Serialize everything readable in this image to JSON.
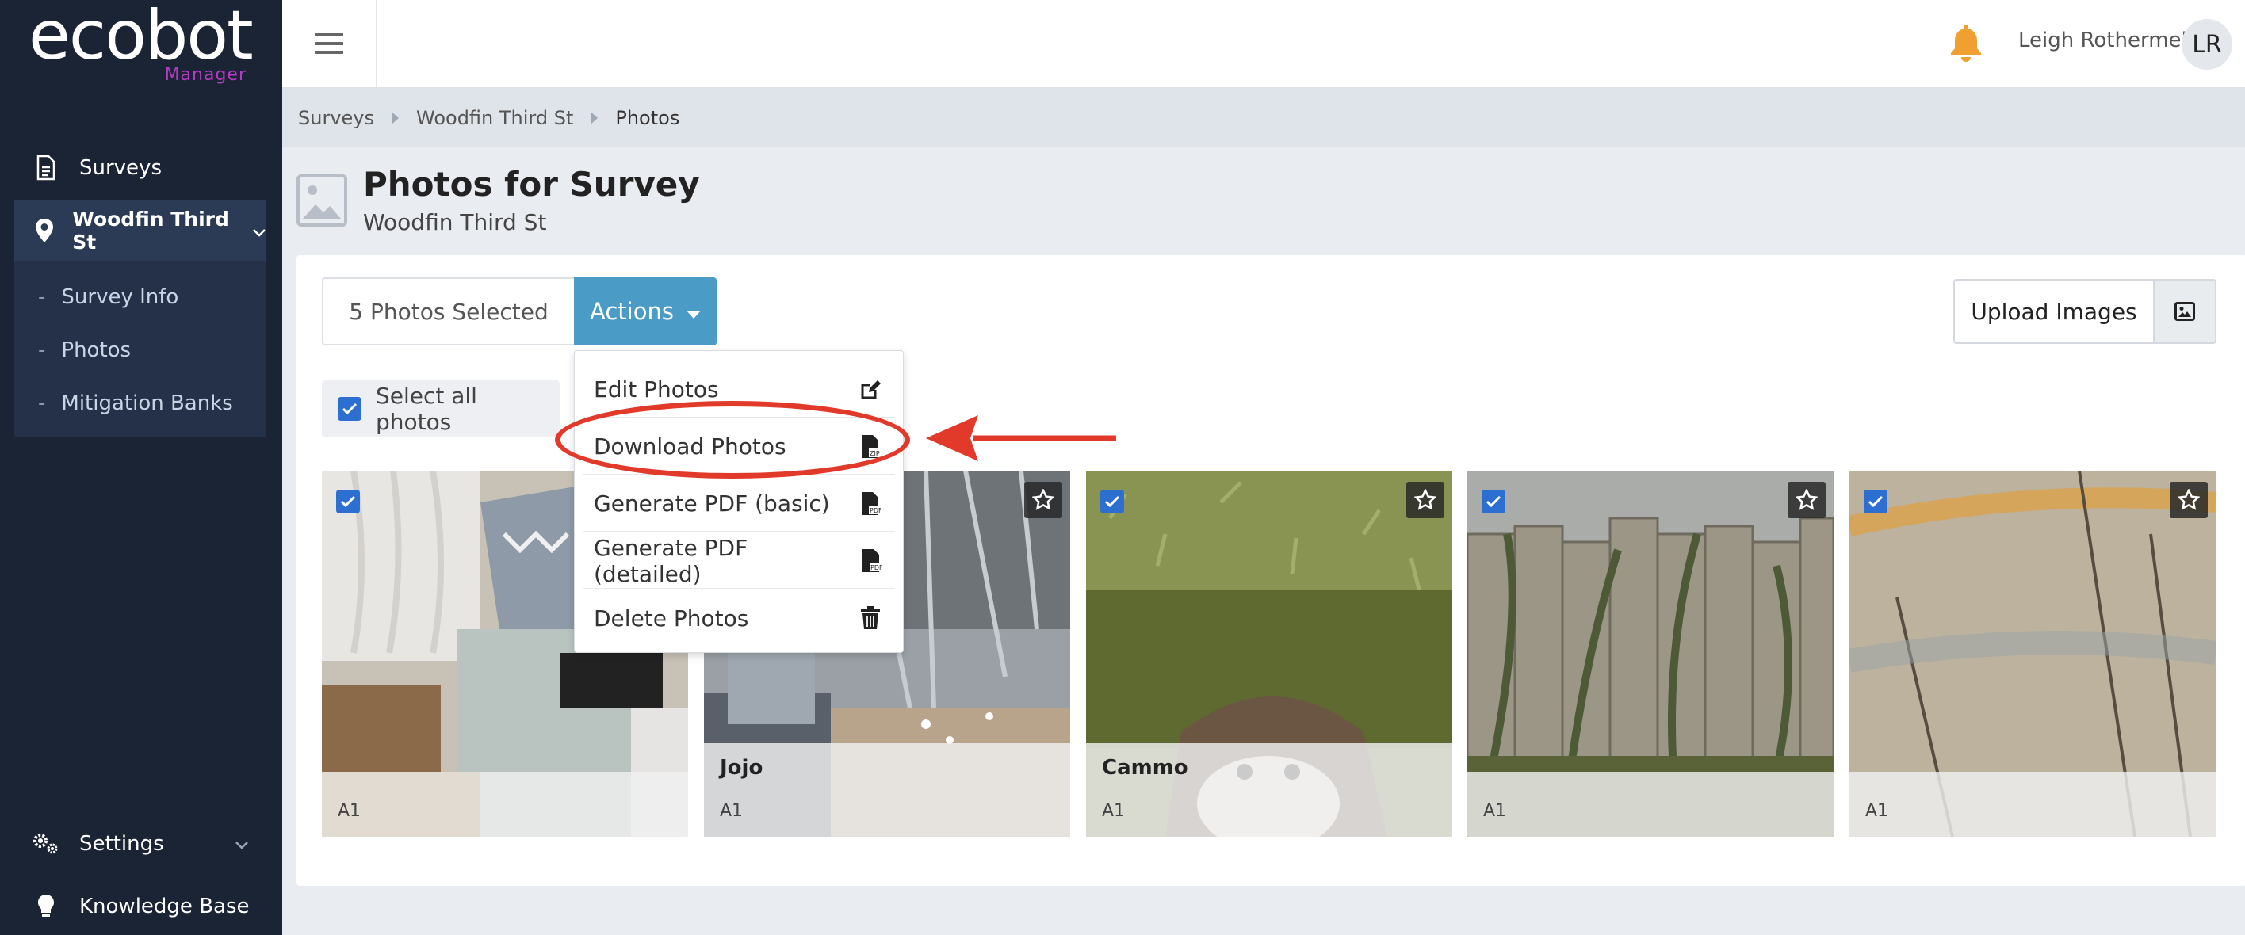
{
  "brand": {
    "logo_text": "ecobot",
    "logo_sub": "Manager",
    "sub_color": "#b43bc3"
  },
  "sidebar": {
    "surveys_label": "Surveys",
    "current_survey": "Woodfin Third St",
    "sub_items": [
      "Survey Info",
      "Photos",
      "Mitigation Banks"
    ],
    "settings_label": "Settings",
    "knowledge_label": "Knowledge Base"
  },
  "topbar": {
    "user_name": "Leigh Rothermel",
    "initials": "LR",
    "bell_color": "#f0a030"
  },
  "breadcrumb": [
    "Surveys",
    "Woodfin Third St",
    "Photos"
  ],
  "page": {
    "title": "Photos for Survey",
    "subtitle": "Woodfin Third St"
  },
  "toolbar": {
    "selected_label": "5 Photos Selected",
    "actions_label": "Actions",
    "upload_label": "Upload Images",
    "select_all_label": "Select all photos"
  },
  "actions_menu": [
    {
      "label": "Edit Photos",
      "icon": "edit-icon"
    },
    {
      "label": "Download Photos",
      "icon": "file-zip-icon"
    },
    {
      "label": "Generate PDF (basic)",
      "icon": "file-pdf-icon"
    },
    {
      "label": "Generate PDF (detailed)",
      "icon": "file-pdf-icon"
    },
    {
      "label": "Delete Photos",
      "icon": "trash-icon"
    }
  ],
  "photos": [
    {
      "name": "",
      "tag": "A1",
      "checked": true
    },
    {
      "name": "Jojo",
      "tag": "A1",
      "checked": true
    },
    {
      "name": "Cammo",
      "tag": "A1",
      "checked": true
    },
    {
      "name": "",
      "tag": "A1",
      "checked": true
    },
    {
      "name": "",
      "tag": "A1",
      "checked": true
    }
  ],
  "colors": {
    "accent": "#4a9cc7",
    "checkbox": "#2d6fd1",
    "annotation": "#e23a2a",
    "sidebar": "#1b2434"
  }
}
